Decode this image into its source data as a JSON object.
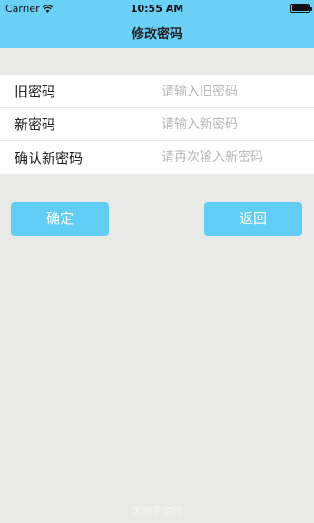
{
  "status_bar": {
    "carrier": "Carrier",
    "time": "10:55 AM",
    "wifi_icon": "wifi-icon",
    "battery_icon": "battery-icon"
  },
  "nav": {
    "title": "修改密码",
    "background_color": "#69d0f6"
  },
  "form": {
    "fields": [
      {
        "label": "旧密码",
        "value": "",
        "placeholder": "请输入旧密码"
      },
      {
        "label": "新密码",
        "value": "",
        "placeholder": "请输入新密码"
      },
      {
        "label": "确认新密码",
        "value": "",
        "placeholder": "请再次输入新密码"
      }
    ]
  },
  "buttons": {
    "confirm_label": "确定",
    "back_label": "返回",
    "color": "#5fcdf4"
  },
  "watermark": "天地手游网"
}
